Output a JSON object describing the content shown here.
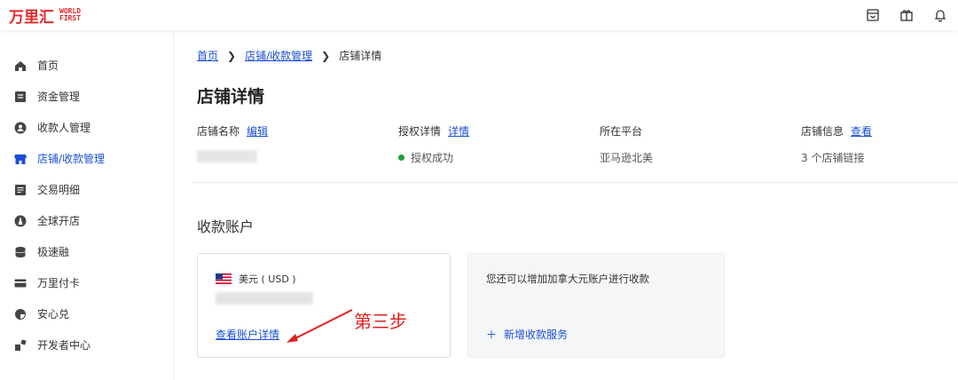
{
  "header": {
    "logo_cn": "万里汇",
    "logo_en_line1": "WORLD",
    "logo_en_line2": "FIRST",
    "icons": [
      "inbox-icon",
      "gift-icon",
      "bell-icon"
    ]
  },
  "sidebar": {
    "items": [
      {
        "label": "首页",
        "icon": "home-icon"
      },
      {
        "label": "资金管理",
        "icon": "fund-icon"
      },
      {
        "label": "收款人管理",
        "icon": "user-icon"
      },
      {
        "label": "店铺/收款管理",
        "icon": "store-icon",
        "active": true
      },
      {
        "label": "交易明细",
        "icon": "ledger-icon"
      },
      {
        "label": "全球开店",
        "icon": "globe-icon"
      },
      {
        "label": "极速融",
        "icon": "coins-icon"
      },
      {
        "label": "万里付卡",
        "icon": "card-icon"
      },
      {
        "label": "安心兑",
        "icon": "exchange-icon"
      },
      {
        "label": "开发者中心",
        "icon": "developer-icon"
      }
    ],
    "active_color": "#1a4fd6"
  },
  "breadcrumb": {
    "home": "首页",
    "parent": "店铺/收款管理",
    "current": "店铺详情"
  },
  "page_title": "店铺详情",
  "info": {
    "store_name_label": "店铺名称",
    "store_name_edit": "编辑",
    "auth_label": "授权详情",
    "auth_link": "详情",
    "auth_status": "授权成功",
    "platform_label": "所在平台",
    "platform_value": "亚马逊北美",
    "store_info_label": "店铺信息",
    "store_info_link": "查看",
    "store_info_value": "3 个店铺链接"
  },
  "section_title": "收款账户",
  "account_card": {
    "currency": "美元 ( USD )",
    "detail_link": "查看账户详情"
  },
  "add_card": {
    "text": "您还可以增加加拿大元账户进行收款",
    "action": "新增收款服务"
  },
  "annotation": "第三步",
  "colors": {
    "brand": "#e02a2a",
    "link": "#1a4fd6",
    "success": "#1aa33a",
    "annotation": "#e02020"
  }
}
